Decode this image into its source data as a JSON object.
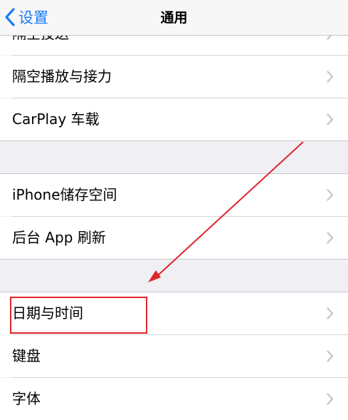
{
  "navbar": {
    "back_label": "设置",
    "title": "通用"
  },
  "icons": {
    "back": "chevron-left-icon",
    "row": "chevron-right-icon"
  },
  "groups": [
    {
      "items": [
        "隔空投送",
        "隔空播放与接力",
        "CarPlay 车载"
      ]
    },
    {
      "items": [
        "iPhone储存空间",
        "后台 App 刷新"
      ]
    },
    {
      "items": [
        "日期与时间",
        "键盘",
        "字体"
      ]
    }
  ],
  "annotation": {
    "highlighted_item": "日期与时间",
    "color": "#e1252d"
  },
  "colors": {
    "accent": "#1a7cf5",
    "background": "#efeff4",
    "chevron": "#c4c4c9"
  }
}
